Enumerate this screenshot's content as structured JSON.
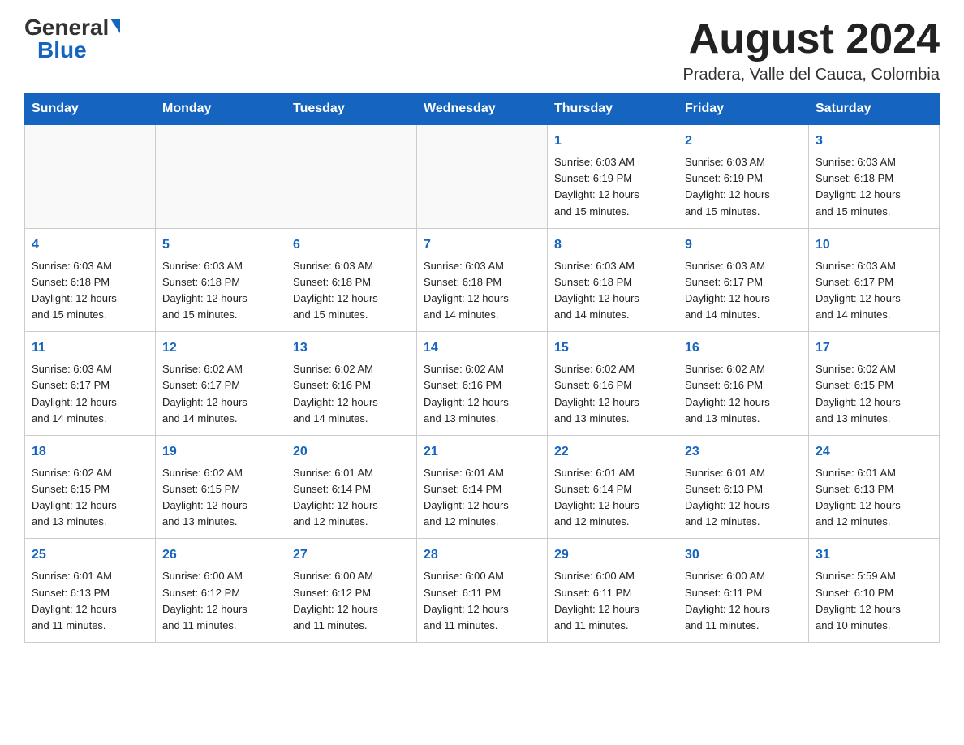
{
  "header": {
    "logo_general": "General",
    "logo_blue": "Blue",
    "month_title": "August 2024",
    "location": "Pradera, Valle del Cauca, Colombia"
  },
  "weekdays": [
    "Sunday",
    "Monday",
    "Tuesday",
    "Wednesday",
    "Thursday",
    "Friday",
    "Saturday"
  ],
  "weeks": [
    [
      {
        "day": "",
        "info": ""
      },
      {
        "day": "",
        "info": ""
      },
      {
        "day": "",
        "info": ""
      },
      {
        "day": "",
        "info": ""
      },
      {
        "day": "1",
        "info": "Sunrise: 6:03 AM\nSunset: 6:19 PM\nDaylight: 12 hours\nand 15 minutes."
      },
      {
        "day": "2",
        "info": "Sunrise: 6:03 AM\nSunset: 6:19 PM\nDaylight: 12 hours\nand 15 minutes."
      },
      {
        "day": "3",
        "info": "Sunrise: 6:03 AM\nSunset: 6:18 PM\nDaylight: 12 hours\nand 15 minutes."
      }
    ],
    [
      {
        "day": "4",
        "info": "Sunrise: 6:03 AM\nSunset: 6:18 PM\nDaylight: 12 hours\nand 15 minutes."
      },
      {
        "day": "5",
        "info": "Sunrise: 6:03 AM\nSunset: 6:18 PM\nDaylight: 12 hours\nand 15 minutes."
      },
      {
        "day": "6",
        "info": "Sunrise: 6:03 AM\nSunset: 6:18 PM\nDaylight: 12 hours\nand 15 minutes."
      },
      {
        "day": "7",
        "info": "Sunrise: 6:03 AM\nSunset: 6:18 PM\nDaylight: 12 hours\nand 14 minutes."
      },
      {
        "day": "8",
        "info": "Sunrise: 6:03 AM\nSunset: 6:18 PM\nDaylight: 12 hours\nand 14 minutes."
      },
      {
        "day": "9",
        "info": "Sunrise: 6:03 AM\nSunset: 6:17 PM\nDaylight: 12 hours\nand 14 minutes."
      },
      {
        "day": "10",
        "info": "Sunrise: 6:03 AM\nSunset: 6:17 PM\nDaylight: 12 hours\nand 14 minutes."
      }
    ],
    [
      {
        "day": "11",
        "info": "Sunrise: 6:03 AM\nSunset: 6:17 PM\nDaylight: 12 hours\nand 14 minutes."
      },
      {
        "day": "12",
        "info": "Sunrise: 6:02 AM\nSunset: 6:17 PM\nDaylight: 12 hours\nand 14 minutes."
      },
      {
        "day": "13",
        "info": "Sunrise: 6:02 AM\nSunset: 6:16 PM\nDaylight: 12 hours\nand 14 minutes."
      },
      {
        "day": "14",
        "info": "Sunrise: 6:02 AM\nSunset: 6:16 PM\nDaylight: 12 hours\nand 13 minutes."
      },
      {
        "day": "15",
        "info": "Sunrise: 6:02 AM\nSunset: 6:16 PM\nDaylight: 12 hours\nand 13 minutes."
      },
      {
        "day": "16",
        "info": "Sunrise: 6:02 AM\nSunset: 6:16 PM\nDaylight: 12 hours\nand 13 minutes."
      },
      {
        "day": "17",
        "info": "Sunrise: 6:02 AM\nSunset: 6:15 PM\nDaylight: 12 hours\nand 13 minutes."
      }
    ],
    [
      {
        "day": "18",
        "info": "Sunrise: 6:02 AM\nSunset: 6:15 PM\nDaylight: 12 hours\nand 13 minutes."
      },
      {
        "day": "19",
        "info": "Sunrise: 6:02 AM\nSunset: 6:15 PM\nDaylight: 12 hours\nand 13 minutes."
      },
      {
        "day": "20",
        "info": "Sunrise: 6:01 AM\nSunset: 6:14 PM\nDaylight: 12 hours\nand 12 minutes."
      },
      {
        "day": "21",
        "info": "Sunrise: 6:01 AM\nSunset: 6:14 PM\nDaylight: 12 hours\nand 12 minutes."
      },
      {
        "day": "22",
        "info": "Sunrise: 6:01 AM\nSunset: 6:14 PM\nDaylight: 12 hours\nand 12 minutes."
      },
      {
        "day": "23",
        "info": "Sunrise: 6:01 AM\nSunset: 6:13 PM\nDaylight: 12 hours\nand 12 minutes."
      },
      {
        "day": "24",
        "info": "Sunrise: 6:01 AM\nSunset: 6:13 PM\nDaylight: 12 hours\nand 12 minutes."
      }
    ],
    [
      {
        "day": "25",
        "info": "Sunrise: 6:01 AM\nSunset: 6:13 PM\nDaylight: 12 hours\nand 11 minutes."
      },
      {
        "day": "26",
        "info": "Sunrise: 6:00 AM\nSunset: 6:12 PM\nDaylight: 12 hours\nand 11 minutes."
      },
      {
        "day": "27",
        "info": "Sunrise: 6:00 AM\nSunset: 6:12 PM\nDaylight: 12 hours\nand 11 minutes."
      },
      {
        "day": "28",
        "info": "Sunrise: 6:00 AM\nSunset: 6:11 PM\nDaylight: 12 hours\nand 11 minutes."
      },
      {
        "day": "29",
        "info": "Sunrise: 6:00 AM\nSunset: 6:11 PM\nDaylight: 12 hours\nand 11 minutes."
      },
      {
        "day": "30",
        "info": "Sunrise: 6:00 AM\nSunset: 6:11 PM\nDaylight: 12 hours\nand 11 minutes."
      },
      {
        "day": "31",
        "info": "Sunrise: 5:59 AM\nSunset: 6:10 PM\nDaylight: 12 hours\nand 10 minutes."
      }
    ]
  ],
  "colors": {
    "header_bg": "#1565c0",
    "accent": "#1565c0"
  }
}
